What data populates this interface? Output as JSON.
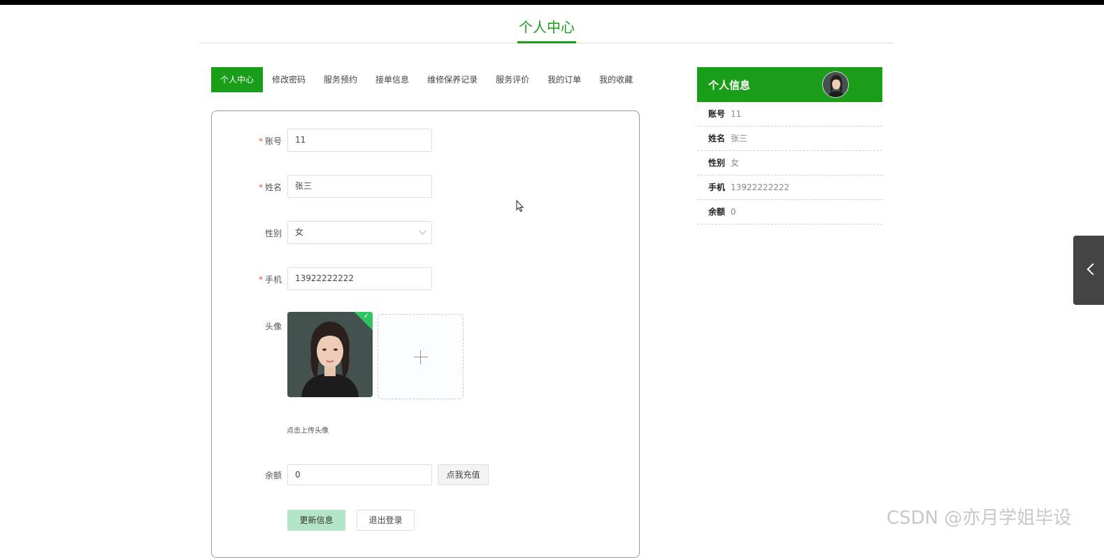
{
  "page": {
    "title": "个人中心"
  },
  "tabs": [
    {
      "label": "个人中心",
      "active": true
    },
    {
      "label": "修改密码",
      "active": false
    },
    {
      "label": "服务预约",
      "active": false
    },
    {
      "label": "接单信息",
      "active": false
    },
    {
      "label": "维修保养记录",
      "active": false
    },
    {
      "label": "服务评价",
      "active": false
    },
    {
      "label": "我的订单",
      "active": false
    },
    {
      "label": "我的收藏",
      "active": false
    }
  ],
  "form": {
    "account": {
      "label": "账号",
      "value": "11",
      "required": true
    },
    "name": {
      "label": "姓名",
      "value": "张三",
      "required": true
    },
    "gender": {
      "label": "性别",
      "value": "女",
      "required": false
    },
    "phone": {
      "label": "手机",
      "value": "13922222222",
      "required": true
    },
    "avatar": {
      "label": "头像",
      "tip": "点击上传头像"
    },
    "balance": {
      "label": "余额",
      "value": "0",
      "recharge_label": "点我充值"
    },
    "update_label": "更新信息",
    "logout_label": "退出登录"
  },
  "info": {
    "title": "个人信息",
    "rows": [
      {
        "key": "账号",
        "value": "11"
      },
      {
        "key": "姓名",
        "value": "张三"
      },
      {
        "key": "性别",
        "value": "女"
      },
      {
        "key": "手机",
        "value": "13922222222"
      },
      {
        "key": "余额",
        "value": "0"
      }
    ]
  },
  "watermark": "CSDN @亦月学姐毕设",
  "colors": {
    "accent": "#1a9e1a",
    "update_button": "#b3e6c8",
    "required": "#e5534b"
  }
}
